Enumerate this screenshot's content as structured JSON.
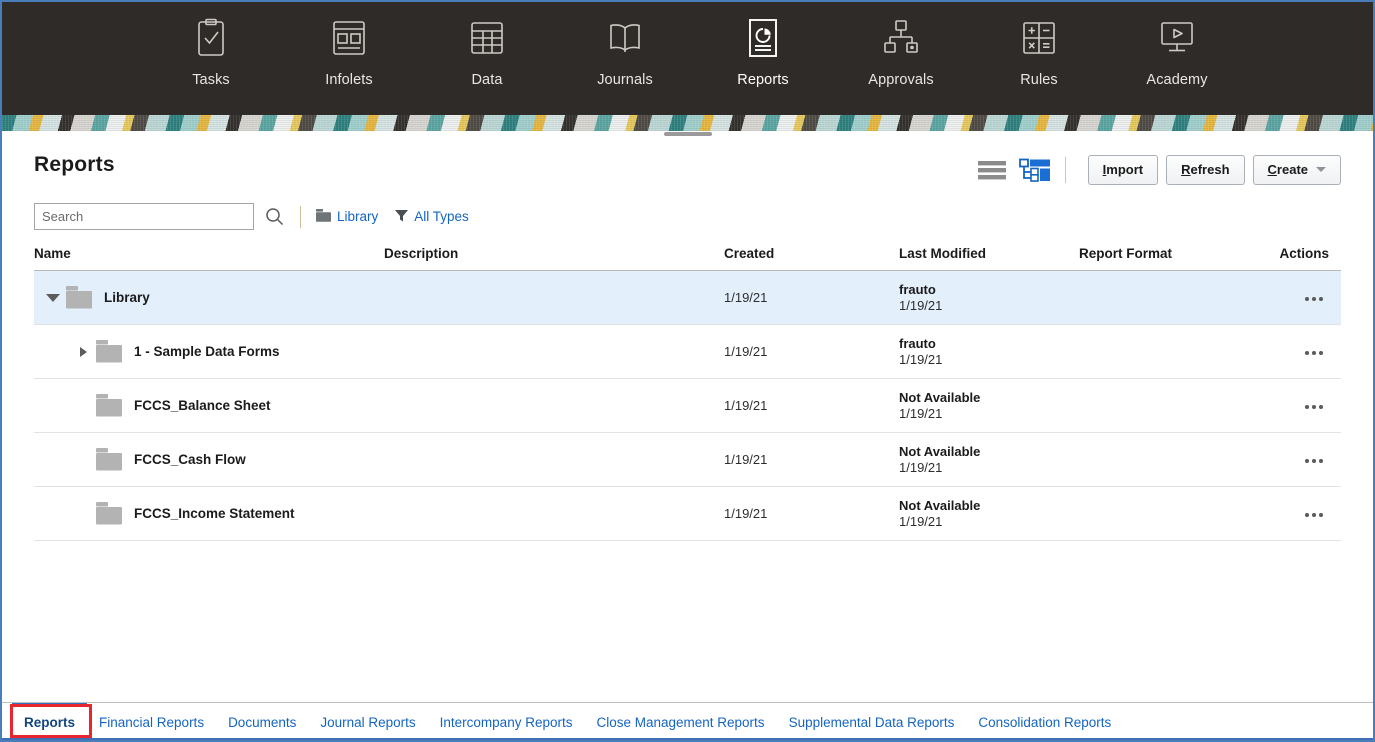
{
  "topnav": {
    "items": [
      {
        "label": "Tasks",
        "icon": "clipboard-check-icon",
        "selected": false
      },
      {
        "label": "Infolets",
        "icon": "infolets-icon",
        "selected": false
      },
      {
        "label": "Data",
        "icon": "data-grid-icon",
        "selected": false
      },
      {
        "label": "Journals",
        "icon": "book-icon",
        "selected": false
      },
      {
        "label": "Reports",
        "icon": "reports-chart-icon",
        "selected": true
      },
      {
        "label": "Approvals",
        "icon": "approvals-hierarchy-icon",
        "selected": false
      },
      {
        "label": "Rules",
        "icon": "rules-calculator-icon",
        "selected": false
      },
      {
        "label": "Academy",
        "icon": "academy-monitor-play-icon",
        "selected": false
      }
    ]
  },
  "header": {
    "title": "Reports",
    "view_list_icon": "list-view-icon",
    "view_tree_icon": "tree-view-icon",
    "buttons": [
      {
        "name": "import",
        "label": "Import",
        "accel": "I",
        "dropdown": false
      },
      {
        "name": "refresh",
        "label": "Refresh",
        "accel": "R",
        "dropdown": false
      },
      {
        "name": "create",
        "label": "Create",
        "accel": "C",
        "dropdown": true
      }
    ]
  },
  "search": {
    "placeholder": "Search",
    "value": "",
    "search_icon": "search-icon",
    "chips": [
      {
        "label": "Library",
        "icon": "folder-icon"
      },
      {
        "label": "All Types",
        "icon": "filter-funnel-icon"
      }
    ]
  },
  "table": {
    "columns": [
      "Name",
      "Description",
      "Created",
      "Last Modified",
      "Report Format",
      "Actions"
    ],
    "rows": [
      {
        "name": "Library",
        "description": "",
        "created": "1/19/21",
        "modified_by": "frauto",
        "modified_date": "1/19/21",
        "format": "",
        "indent": 0,
        "twisty": "expanded",
        "selected": true,
        "actions_icon": "more-actions-icon"
      },
      {
        "name": "1 - Sample Data Forms",
        "description": "",
        "created": "1/19/21",
        "modified_by": "frauto",
        "modified_date": "1/19/21",
        "format": "",
        "indent": 1,
        "twisty": "collapsed",
        "selected": false,
        "actions_icon": "more-actions-icon"
      },
      {
        "name": "FCCS_Balance Sheet",
        "description": "",
        "created": "1/19/21",
        "modified_by": "Not Available",
        "modified_date": "1/19/21",
        "format": "",
        "indent": 1,
        "twisty": "none",
        "selected": false,
        "actions_icon": "more-actions-icon"
      },
      {
        "name": "FCCS_Cash Flow",
        "description": "",
        "created": "1/19/21",
        "modified_by": "Not Available",
        "modified_date": "1/19/21",
        "format": "",
        "indent": 1,
        "twisty": "none",
        "selected": false,
        "actions_icon": "more-actions-icon"
      },
      {
        "name": "FCCS_Income Statement",
        "description": "",
        "created": "1/19/21",
        "modified_by": "Not Available",
        "modified_date": "1/19/21",
        "format": "",
        "indent": 1,
        "twisty": "none",
        "selected": false,
        "actions_icon": "more-actions-icon"
      }
    ]
  },
  "tabbar": {
    "tabs": [
      {
        "label": "Reports",
        "active": true
      },
      {
        "label": "Financial Reports",
        "active": false
      },
      {
        "label": "Documents",
        "active": false
      },
      {
        "label": "Journal Reports",
        "active": false
      },
      {
        "label": "Intercompany Reports",
        "active": false
      },
      {
        "label": "Close Management Reports",
        "active": false
      },
      {
        "label": "Supplemental Data Reports",
        "active": false
      },
      {
        "label": "Consolidation Reports",
        "active": false
      }
    ],
    "annotation_color": "#e8262d"
  },
  "colors": {
    "nav_background": "#2f2b28",
    "link_blue": "#1565c0",
    "selected_row": "#e3effb",
    "tab_active_border": "#2f6fbd",
    "frame_border": "#4a7ebb"
  }
}
